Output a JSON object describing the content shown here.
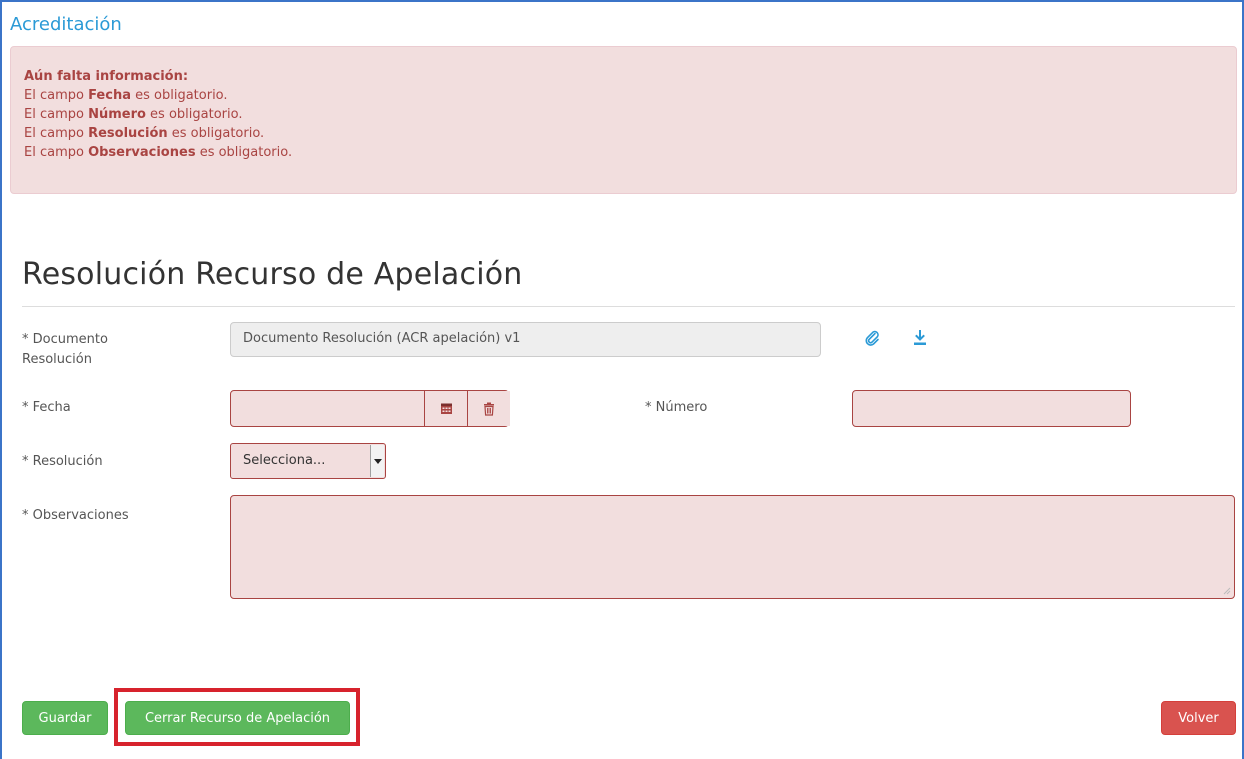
{
  "app": {
    "title": "Acreditación"
  },
  "alert": {
    "heading": "Aún falta información:",
    "lines": [
      {
        "prefix": "El campo ",
        "field": "Fecha",
        "suffix": " es obligatorio."
      },
      {
        "prefix": "El campo ",
        "field": "Número",
        "suffix": " es obligatorio."
      },
      {
        "prefix": "El campo ",
        "field": "Resolución",
        "suffix": " es obligatorio."
      },
      {
        "prefix": "El campo ",
        "field": "Observaciones",
        "suffix": " es obligatorio."
      }
    ]
  },
  "form": {
    "title": "Resolución Recurso de Apelación",
    "documento": {
      "label_line1": "* Documento",
      "label_line2": "Resolución",
      "value": "Documento Resolución (ACR apelación) v1",
      "attach_icon": "paperclip-icon",
      "download_icon": "download-icon"
    },
    "fecha": {
      "label": "* Fecha",
      "value": "",
      "calendar_icon": "calendar-icon",
      "clear_icon": "trash-icon"
    },
    "numero": {
      "label": "* Número",
      "value": ""
    },
    "resolucion": {
      "label": "* Resolución",
      "selected": "Selecciona..."
    },
    "observaciones": {
      "label": "* Observaciones",
      "value": ""
    }
  },
  "buttons": {
    "guardar": "Guardar",
    "cerrar": "Cerrar Recurso de Apelación",
    "volver": "Volver"
  },
  "colors": {
    "accent": "#2b9ad6",
    "error_bg": "#f2dede",
    "error_text": "#a94442",
    "success": "#5cb85c",
    "danger": "#d9534f",
    "highlight": "#d7232d"
  }
}
